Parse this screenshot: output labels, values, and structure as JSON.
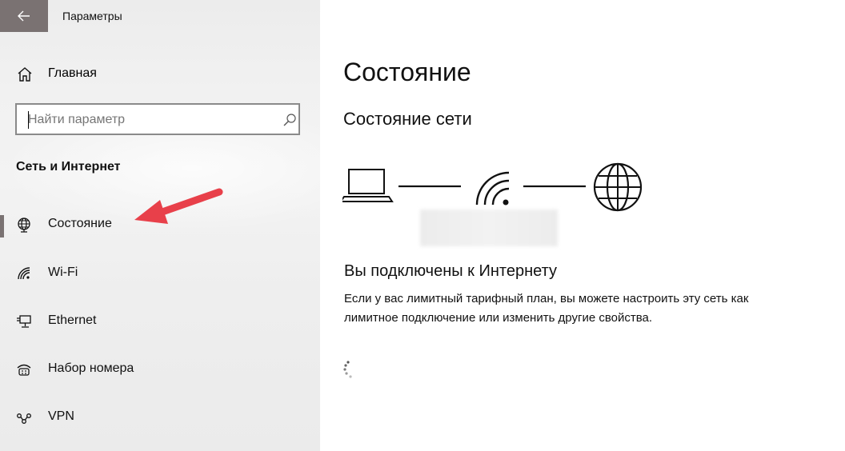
{
  "window": {
    "title": "Параметры"
  },
  "sidebar": {
    "home_label": "Главная",
    "search_placeholder": "Найти параметр",
    "section_title": "Сеть и Интернет",
    "items": [
      {
        "label": "Состояние",
        "icon": "globe-network-icon",
        "selected": true
      },
      {
        "label": "Wi-Fi",
        "icon": "wifi-icon"
      },
      {
        "label": "Ethernet",
        "icon": "ethernet-icon"
      },
      {
        "label": "Набор номера",
        "icon": "dialup-icon"
      },
      {
        "label": "VPN",
        "icon": "vpn-icon"
      }
    ]
  },
  "main": {
    "title": "Состояние",
    "network_status_title": "Состояние сети",
    "connected_title": "Вы подключены к Интернету",
    "connected_desc": "Если у вас лимитный тарифный план, вы можете настроить эту сеть как лимитное подключение или изменить другие свойства."
  },
  "colors": {
    "accent": "#7a7272",
    "annotation_arrow": "#e8404a"
  }
}
